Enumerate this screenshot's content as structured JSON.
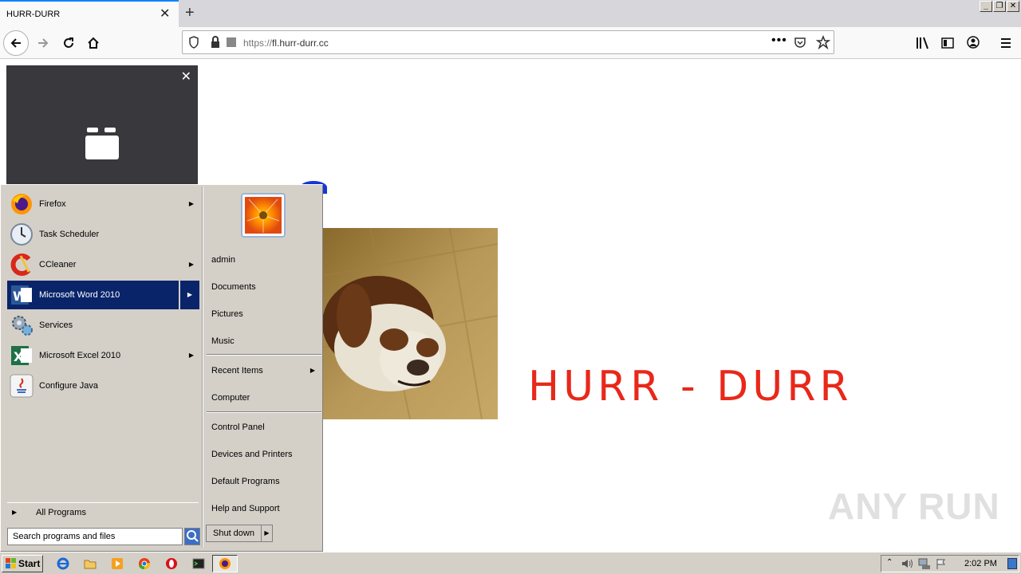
{
  "browser": {
    "tab_title": "HURR-DURR",
    "url_scheme": "https://",
    "url_host": "fl.hurr-durr.cc"
  },
  "page": {
    "headline": "HURR - DURR",
    "watermark": "ANY RUN"
  },
  "start_menu": {
    "programs": [
      {
        "label": "Firefox",
        "icon": "firefox-icon",
        "has_submenu": true
      },
      {
        "label": "Task Scheduler",
        "icon": "clock-icon",
        "has_submenu": false
      },
      {
        "label": "CCleaner",
        "icon": "ccleaner-icon",
        "has_submenu": true
      },
      {
        "label": "Microsoft Word 2010",
        "icon": "word-icon",
        "has_submenu": true,
        "selected": true
      },
      {
        "label": "Services",
        "icon": "gears-icon",
        "has_submenu": false
      },
      {
        "label": "Microsoft Excel 2010",
        "icon": "excel-icon",
        "has_submenu": true
      },
      {
        "label": "Configure Java",
        "icon": "java-icon",
        "has_submenu": false
      }
    ],
    "all_programs": "All Programs",
    "search_placeholder": "Search programs and files",
    "places": [
      "admin",
      "Documents",
      "Pictures",
      "Music",
      "Recent Items",
      "Computer",
      "Control Panel",
      "Devices and Printers",
      "Default Programs",
      "Help and Support"
    ],
    "shutdown": "Shut down"
  },
  "taskbar": {
    "start_label": "Start",
    "clock": "2:02 PM"
  },
  "colors": {
    "headline": "#e8281a",
    "selection": "#0a246a",
    "classic_face": "#d4d0c8"
  }
}
